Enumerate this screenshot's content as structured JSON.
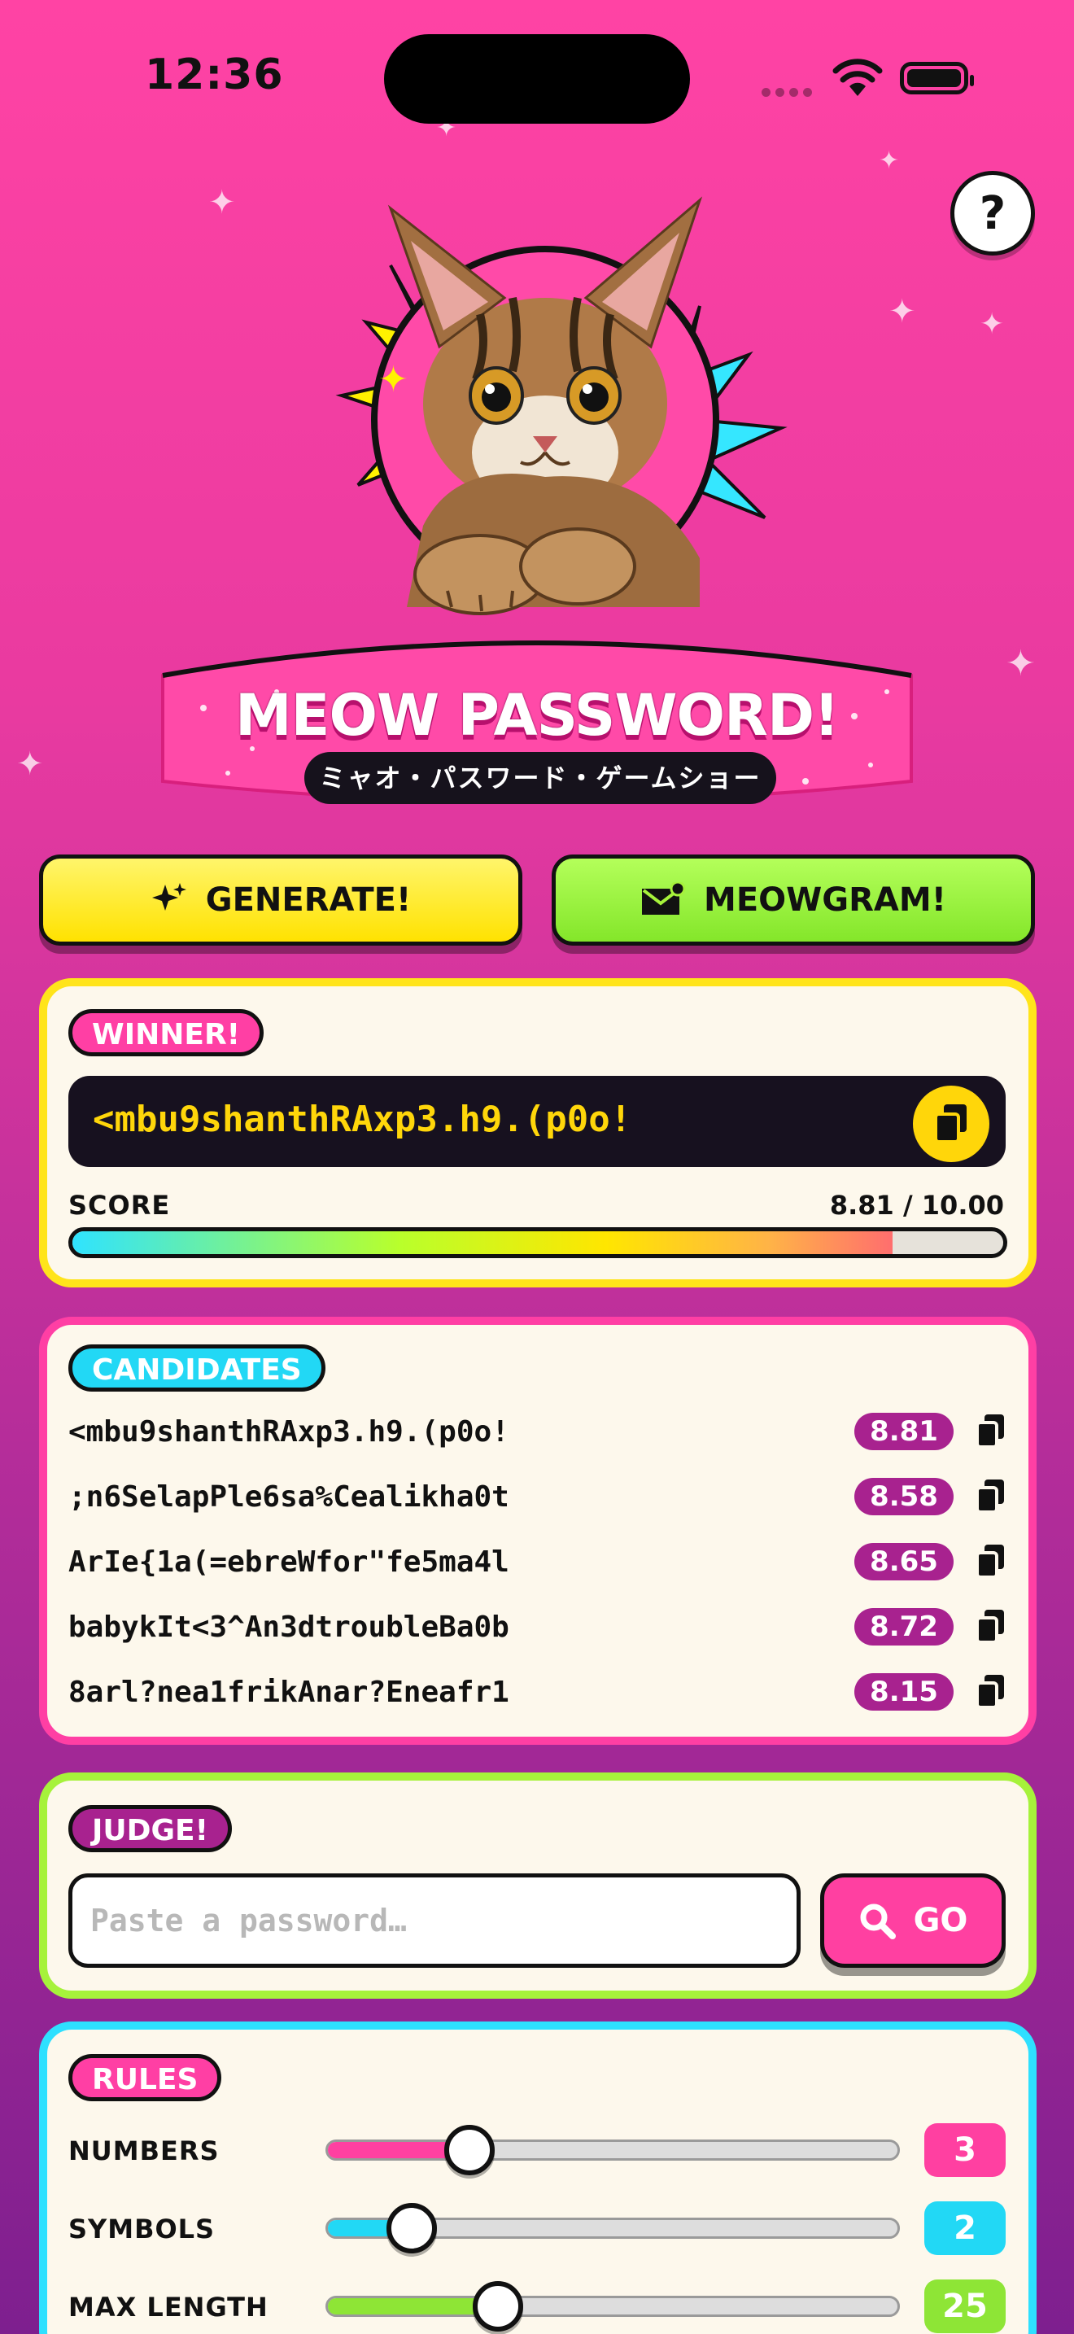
{
  "status": {
    "time": "12:36"
  },
  "header": {
    "title": "MEOW PASSWORD!",
    "subtitle": "ミャオ・パスワード・ゲームショー",
    "help_label": "?"
  },
  "actions": {
    "generate_label": "GENERATE!",
    "meowgram_label": "MEOWGRAM!"
  },
  "winner": {
    "badge": "WINNER!",
    "password": "<mbu9shanthRAxp3.h9.(p0o!",
    "score_label": "SCORE",
    "score_text": "8.81 / 10.00",
    "score_value": 8.81,
    "score_max": 10
  },
  "candidates": {
    "badge": "CANDIDATES",
    "items": [
      {
        "password": "<mbu9shanthRAxp3.h9.(p0o!",
        "score": "8.81"
      },
      {
        "password": ";n6SelapPle6sa%Cealikha0t",
        "score": "8.58"
      },
      {
        "password": "ArIe{1a(=ebreWfor\"fe5ma4l",
        "score": "8.65"
      },
      {
        "password": "babykIt<3^An3dtroubleBa0b",
        "score": "8.72"
      },
      {
        "password": "8arl?nea1frikAnar?Eneafr1",
        "score": "8.15"
      }
    ]
  },
  "judge": {
    "badge": "JUDGE!",
    "placeholder": "Paste a password…",
    "go_label": "GO"
  },
  "rules": {
    "badge": "RULES",
    "items": [
      {
        "label": "NUMBERS",
        "value": "3",
        "level": 0.25,
        "color": "#ff40a1"
      },
      {
        "label": "SYMBOLS",
        "value": "2",
        "level": 0.15,
        "color": "#22d8f5"
      },
      {
        "label": "MAX LENGTH",
        "value": "25",
        "level": 0.3,
        "color": "#8ee536"
      }
    ]
  },
  "colors": {
    "yellow": "#ffe41b",
    "pink": "#ff3fa4",
    "lime": "#a6f23b",
    "cyan": "#2ee0ff",
    "purple": "#a8228f"
  }
}
